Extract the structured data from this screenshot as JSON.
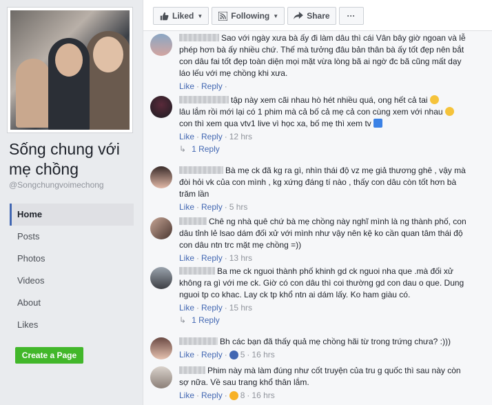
{
  "page": {
    "name": "Sống chung với mẹ chồng",
    "handle": "@Songchungvoimechong"
  },
  "nav": {
    "items": [
      "Home",
      "Posts",
      "Photos",
      "Videos",
      "About",
      "Likes"
    ],
    "active": "Home"
  },
  "create_page_label": "Create a Page",
  "actions": {
    "liked": "Liked",
    "following": "Following",
    "share": "Share",
    "more": "···"
  },
  "comments": [
    {
      "text": "Sao với ngày xưa bà ấy đi làm dâu thì cái Vân bây giờ ngoan và lễ phép hơn bà ấy nhiều chứ. Thế mà tưởng đâu bản thân bà ấy tốt đẹp nên bắt con dâu fai tốt đẹp toàn diện mọi mặt vừa lòng bã ai ngờ đc bã cũng mất dạy láo lếu với mẹ chồng khi xưa.",
      "like": "Like",
      "reply": "Reply",
      "time": ""
    },
    {
      "text": "tập này xem cãi nhau hò hét nhiều quá, ong hết cả tai",
      "text2": "lâu lắm rồi mới lại có 1 phim mà cả bố cả mẹ cả con cùng xem với nhau",
      "text3": "con thì xem qua vtv1 live vì học xa, bố mẹ thì xem tv",
      "like": "Like",
      "reply": "Reply",
      "time": "12 hrs",
      "replies": "1 Reply"
    },
    {
      "text": "Bà mẹ ck đã kg ra gì, nhìn thái độ vz mẹ giả thương ghê , vậy mà đòi hỏi vk của con mình , kg xứng đáng tí nào , thấy con dâu còn tốt hơn bà trăm lần",
      "like": "Like",
      "reply": "Reply",
      "time": "5 hrs"
    },
    {
      "text": "Chê ng nhà quê chứ bà mẹ chồng này nghĩ mình là ng thành phố, con dâu tỉnh lẻ lsao dám đối xử với mình như vậy nên kệ ko cần quan tâm thái độ con dâu ntn trc mặt mẹ chồng =))",
      "like": "Like",
      "reply": "Reply",
      "time": "13 hrs"
    },
    {
      "text": "Ba me ck nguoi thành phố khinh gd ck nguoi nha que .mà đối xử không ra gì với me ck. Giờ có con dâu thì coi thường gd con dau o que. Dung nguoi tp co khac. Lay ck tp khổ ntn ai dám lấy. Ko ham giàu có.",
      "like": "Like",
      "reply": "Reply",
      "time": "15 hrs",
      "replies": "1 Reply"
    },
    {
      "text": "Bh các bạn đã thấy quả mẹ chồng hãi từ trong trứng chưa? :)))",
      "like": "Like",
      "reply": "Reply",
      "reactions": "5",
      "time": "16 hrs"
    },
    {
      "text": "Phim này mà làm đúng như cốt truyện của tru g quốc thì sau này còn sợ nữa. Về sau trang khổ thân lắm.",
      "like": "Like",
      "reply": "Reply",
      "reactions": "8",
      "time": "16 hrs"
    }
  ],
  "colors": {
    "link": "#4267b2",
    "meta": "#90949c",
    "create_button": "#42b72a",
    "panel": "#f6f7f9",
    "background": "#e9ebee"
  }
}
